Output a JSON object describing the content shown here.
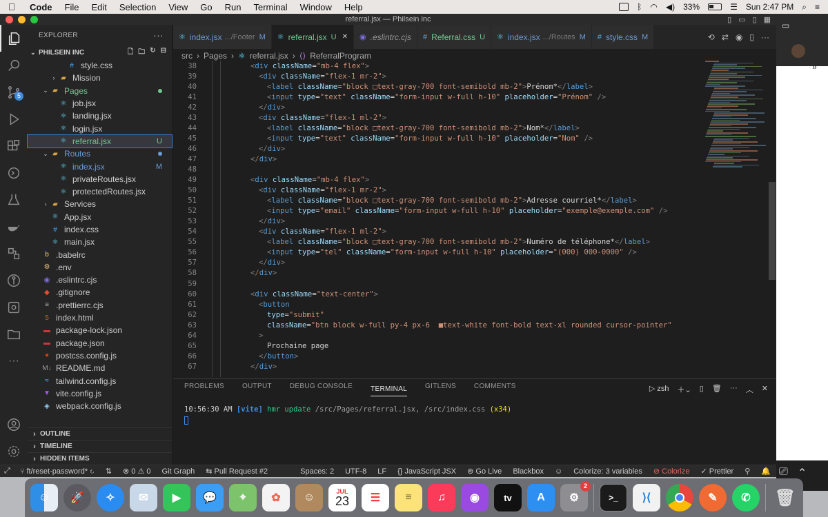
{
  "menubar": {
    "app": "Code",
    "items": [
      "File",
      "Edit",
      "Selection",
      "View",
      "Go",
      "Run",
      "Terminal",
      "Window",
      "Help"
    ],
    "battery": "33%",
    "clock": "Sun 2:47 PM"
  },
  "window": {
    "title": "referral.jsx — Philsein inc"
  },
  "sidebar": {
    "header": "EXPLORER",
    "workspace": "PHILSEIN INC",
    "tree": [
      {
        "name": "style.css",
        "indent": 3,
        "icon": "css",
        "chev": ""
      },
      {
        "name": "Mission",
        "indent": 2,
        "icon": "folder",
        "chev": "›"
      },
      {
        "name": "Pages",
        "indent": 1,
        "icon": "folder-open",
        "chev": "⌄",
        "status": "dot",
        "color": "green"
      },
      {
        "name": "job.jsx",
        "indent": 2,
        "icon": "react",
        "chev": ""
      },
      {
        "name": "landing.jsx",
        "indent": 2,
        "icon": "react",
        "chev": ""
      },
      {
        "name": "login.jsx",
        "indent": 2,
        "icon": "react",
        "chev": ""
      },
      {
        "name": "referral.jsx",
        "indent": 2,
        "icon": "react",
        "chev": "",
        "status": "U",
        "selected": true
      },
      {
        "name": "Routes",
        "indent": 1,
        "icon": "folder-open",
        "chev": "⌄",
        "status": "dot",
        "color": "blue"
      },
      {
        "name": "index.jsx",
        "indent": 2,
        "icon": "react",
        "chev": "",
        "status": "M",
        "color": "blue"
      },
      {
        "name": "privateRoutes.jsx",
        "indent": 2,
        "icon": "react",
        "chev": ""
      },
      {
        "name": "protectedRoutes.jsx",
        "indent": 2,
        "icon": "react",
        "chev": ""
      },
      {
        "name": "Services",
        "indent": 1,
        "icon": "folder",
        "chev": "›"
      },
      {
        "name": "App.jsx",
        "indent": 1,
        "icon": "react",
        "chev": ""
      },
      {
        "name": "index.css",
        "indent": 1,
        "icon": "css",
        "chev": ""
      },
      {
        "name": "main.jsx",
        "indent": 1,
        "icon": "react",
        "chev": ""
      },
      {
        "name": ".babelrc",
        "indent": 0,
        "icon": "babel",
        "chev": ""
      },
      {
        "name": ".env",
        "indent": 0,
        "icon": "env",
        "chev": ""
      },
      {
        "name": ".eslintrc.cjs",
        "indent": 0,
        "icon": "eslint",
        "chev": ""
      },
      {
        "name": ".gitignore",
        "indent": 0,
        "icon": "git",
        "chev": ""
      },
      {
        "name": ".prettierrc.cjs",
        "indent": 0,
        "icon": "prettier",
        "chev": ""
      },
      {
        "name": "index.html",
        "indent": 0,
        "icon": "html",
        "chev": ""
      },
      {
        "name": "package-lock.json",
        "indent": 0,
        "icon": "npm",
        "chev": ""
      },
      {
        "name": "package.json",
        "indent": 0,
        "icon": "npm",
        "chev": ""
      },
      {
        "name": "postcss.config.js",
        "indent": 0,
        "icon": "postcss",
        "chev": ""
      },
      {
        "name": "README.md",
        "indent": 0,
        "icon": "md",
        "chev": ""
      },
      {
        "name": "tailwind.config.js",
        "indent": 0,
        "icon": "tailwind",
        "chev": ""
      },
      {
        "name": "vite.config.js",
        "indent": 0,
        "icon": "vite",
        "chev": ""
      },
      {
        "name": "webpack.config.js",
        "indent": 0,
        "icon": "webpack",
        "chev": ""
      }
    ],
    "sections": [
      "OUTLINE",
      "TIMELINE",
      "HIDDEN ITEMS"
    ]
  },
  "tabs": [
    {
      "label": "index.jsx",
      "sub": ".../Footer",
      "mark": "M",
      "icon": "react",
      "markColor": "#6c9bd6"
    },
    {
      "label": "referral.jsx",
      "sub": "",
      "mark": "U",
      "icon": "react",
      "active": true,
      "markColor": "#73c991"
    },
    {
      "label": ".eslintrc.cjs",
      "sub": "",
      "mark": "",
      "icon": "eslint",
      "italic": true
    },
    {
      "label": "Referral.css",
      "sub": "",
      "mark": "U",
      "icon": "css",
      "markColor": "#73c991"
    },
    {
      "label": "index.jsx",
      "sub": ".../Routes",
      "mark": "M",
      "icon": "react",
      "markColor": "#6c9bd6"
    },
    {
      "label": "style.css",
      "sub": "",
      "mark": "M",
      "icon": "css",
      "markColor": "#6c9bd6"
    }
  ],
  "breadcrumb": [
    "src",
    "Pages",
    "referral.jsx",
    "ReferralProgram"
  ],
  "code": [
    {
      "n": "38",
      "i": 0,
      "h": [
        [
          "p",
          "<"
        ],
        [
          "t",
          "div "
        ],
        [
          "a",
          "className"
        ],
        [
          "x",
          "="
        ],
        [
          "s",
          "\"mb-4 flex\""
        ],
        [
          "p",
          ">"
        ]
      ]
    },
    {
      "n": "39",
      "i": 1,
      "h": [
        [
          "p",
          "<"
        ],
        [
          "t",
          "div "
        ],
        [
          "a",
          "className"
        ],
        [
          "x",
          "="
        ],
        [
          "s",
          "\"flex-1 mr-2\""
        ],
        [
          "p",
          ">"
        ]
      ]
    },
    {
      "n": "40",
      "i": 2,
      "h": [
        [
          "p",
          "<"
        ],
        [
          "t",
          "label "
        ],
        [
          "a",
          "className"
        ],
        [
          "x",
          "="
        ],
        [
          "s",
          "\"block □text-gray-700 font-semibold mb-2\""
        ],
        [
          "p",
          ">"
        ],
        [
          "x",
          "Prénom*"
        ],
        [
          "p",
          "</"
        ],
        [
          "t",
          "label"
        ],
        [
          "p",
          ">"
        ]
      ]
    },
    {
      "n": "41",
      "i": 2,
      "h": [
        [
          "p",
          "<"
        ],
        [
          "t",
          "input "
        ],
        [
          "a",
          "type"
        ],
        [
          "x",
          "="
        ],
        [
          "s",
          "\"text\" "
        ],
        [
          "a",
          "className"
        ],
        [
          "x",
          "="
        ],
        [
          "s",
          "\"form-input w-full h-10\" "
        ],
        [
          "a",
          "placeholder"
        ],
        [
          "x",
          "="
        ],
        [
          "s",
          "\"Prénom\" "
        ],
        [
          "p",
          "/>"
        ]
      ]
    },
    {
      "n": "42",
      "i": 1,
      "h": [
        [
          "p",
          "</"
        ],
        [
          "t",
          "div"
        ],
        [
          "p",
          ">"
        ]
      ]
    },
    {
      "n": "43",
      "i": 1,
      "h": [
        [
          "p",
          "<"
        ],
        [
          "t",
          "div "
        ],
        [
          "a",
          "className"
        ],
        [
          "x",
          "="
        ],
        [
          "s",
          "\"flex-1 ml-2\""
        ],
        [
          "p",
          ">"
        ]
      ]
    },
    {
      "n": "44",
      "i": 2,
      "h": [
        [
          "p",
          "<"
        ],
        [
          "t",
          "label "
        ],
        [
          "a",
          "className"
        ],
        [
          "x",
          "="
        ],
        [
          "s",
          "\"block □text-gray-700 font-semibold mb-2\""
        ],
        [
          "p",
          ">"
        ],
        [
          "x",
          "Nom*"
        ],
        [
          "p",
          "</"
        ],
        [
          "t",
          "label"
        ],
        [
          "p",
          ">"
        ]
      ]
    },
    {
      "n": "45",
      "i": 2,
      "h": [
        [
          "p",
          "<"
        ],
        [
          "t",
          "input "
        ],
        [
          "a",
          "type"
        ],
        [
          "x",
          "="
        ],
        [
          "s",
          "\"text\" "
        ],
        [
          "a",
          "className"
        ],
        [
          "x",
          "="
        ],
        [
          "s",
          "\"form-input w-full h-10\" "
        ],
        [
          "a",
          "placeholder"
        ],
        [
          "x",
          "="
        ],
        [
          "s",
          "\"Nom\" "
        ],
        [
          "p",
          "/>"
        ]
      ]
    },
    {
      "n": "46",
      "i": 1,
      "h": [
        [
          "p",
          "</"
        ],
        [
          "t",
          "div"
        ],
        [
          "p",
          ">"
        ]
      ]
    },
    {
      "n": "47",
      "i": 0,
      "h": [
        [
          "p",
          "</"
        ],
        [
          "t",
          "div"
        ],
        [
          "p",
          ">"
        ]
      ]
    },
    {
      "n": "48",
      "i": 0,
      "h": []
    },
    {
      "n": "49",
      "i": 0,
      "h": [
        [
          "p",
          "<"
        ],
        [
          "t",
          "div "
        ],
        [
          "a",
          "className"
        ],
        [
          "x",
          "="
        ],
        [
          "s",
          "\"mb-4 flex\""
        ],
        [
          "p",
          ">"
        ]
      ]
    },
    {
      "n": "50",
      "i": 1,
      "h": [
        [
          "p",
          "<"
        ],
        [
          "t",
          "div "
        ],
        [
          "a",
          "className"
        ],
        [
          "x",
          "="
        ],
        [
          "s",
          "\"flex-1 mr-2\""
        ],
        [
          "p",
          ">"
        ]
      ]
    },
    {
      "n": "51",
      "i": 2,
      "h": [
        [
          "p",
          "<"
        ],
        [
          "t",
          "label "
        ],
        [
          "a",
          "className"
        ],
        [
          "x",
          "="
        ],
        [
          "s",
          "\"block □text-gray-700 font-semibold mb-2\""
        ],
        [
          "p",
          ">"
        ],
        [
          "x",
          "Adresse courriel*"
        ],
        [
          "p",
          "</"
        ],
        [
          "t",
          "label"
        ],
        [
          "p",
          ">"
        ]
      ]
    },
    {
      "n": "52",
      "i": 2,
      "h": [
        [
          "p",
          "<"
        ],
        [
          "t",
          "input "
        ],
        [
          "a",
          "type"
        ],
        [
          "x",
          "="
        ],
        [
          "s",
          "\"email\" "
        ],
        [
          "a",
          "className"
        ],
        [
          "x",
          "="
        ],
        [
          "s",
          "\"form-input w-full h-10\" "
        ],
        [
          "a",
          "placeholder"
        ],
        [
          "x",
          "="
        ],
        [
          "s",
          "\"exemple@exemple.com\" "
        ],
        [
          "p",
          "/>"
        ]
      ]
    },
    {
      "n": "53",
      "i": 1,
      "h": [
        [
          "p",
          "</"
        ],
        [
          "t",
          "div"
        ],
        [
          "p",
          ">"
        ]
      ]
    },
    {
      "n": "54",
      "i": 1,
      "h": [
        [
          "p",
          "<"
        ],
        [
          "t",
          "div "
        ],
        [
          "a",
          "className"
        ],
        [
          "x",
          "="
        ],
        [
          "s",
          "\"flex-1 ml-2\""
        ],
        [
          "p",
          ">"
        ]
      ]
    },
    {
      "n": "55",
      "i": 2,
      "h": [
        [
          "p",
          "<"
        ],
        [
          "t",
          "label "
        ],
        [
          "a",
          "className"
        ],
        [
          "x",
          "="
        ],
        [
          "s",
          "\"block □text-gray-700 font-semibold mb-2\""
        ],
        [
          "p",
          ">"
        ],
        [
          "x",
          "Numéro de téléphone*"
        ],
        [
          "p",
          "</"
        ],
        [
          "t",
          "label"
        ],
        [
          "p",
          ">"
        ]
      ]
    },
    {
      "n": "56",
      "i": 2,
      "h": [
        [
          "p",
          "<"
        ],
        [
          "t",
          "input "
        ],
        [
          "a",
          "type"
        ],
        [
          "x",
          "="
        ],
        [
          "s",
          "\"tel\" "
        ],
        [
          "a",
          "className"
        ],
        [
          "x",
          "="
        ],
        [
          "s",
          "\"form-input w-full h-10\" "
        ],
        [
          "a",
          "placeholder"
        ],
        [
          "x",
          "="
        ],
        [
          "s",
          "\"(000) 000-0000\" "
        ],
        [
          "p",
          "/>"
        ]
      ]
    },
    {
      "n": "57",
      "i": 1,
      "h": [
        [
          "p",
          "</"
        ],
        [
          "t",
          "div"
        ],
        [
          "p",
          ">"
        ]
      ]
    },
    {
      "n": "58",
      "i": 0,
      "h": [
        [
          "p",
          "</"
        ],
        [
          "t",
          "div"
        ],
        [
          "p",
          ">"
        ]
      ]
    },
    {
      "n": "59",
      "i": 0,
      "h": []
    },
    {
      "n": "60",
      "i": 0,
      "h": [
        [
          "p",
          "<"
        ],
        [
          "t",
          "div "
        ],
        [
          "a",
          "className"
        ],
        [
          "x",
          "="
        ],
        [
          "s",
          "\"text-center\""
        ],
        [
          "p",
          ">"
        ]
      ]
    },
    {
      "n": "61",
      "i": 1,
      "h": [
        [
          "p",
          "<"
        ],
        [
          "t",
          "button"
        ]
      ]
    },
    {
      "n": "62",
      "i": 2,
      "h": [
        [
          "a",
          "type"
        ],
        [
          "x",
          "="
        ],
        [
          "s",
          "\"submit\""
        ]
      ]
    },
    {
      "n": "63",
      "i": 2,
      "h": [
        [
          "a",
          "className"
        ],
        [
          "x",
          "="
        ],
        [
          "s",
          "\"btn block w-full py-4 px-6  ■text-white font-bold text-xl rounded cursor-pointer\""
        ]
      ]
    },
    {
      "n": "64",
      "i": 1,
      "h": [
        [
          "p",
          ">"
        ]
      ]
    },
    {
      "n": "65",
      "i": 2,
      "h": [
        [
          "x",
          "Prochaine page"
        ]
      ]
    },
    {
      "n": "66",
      "i": 1,
      "h": [
        [
          "p",
          "</"
        ],
        [
          "t",
          "button"
        ],
        [
          "p",
          ">"
        ]
      ]
    },
    {
      "n": "67",
      "i": 0,
      "h": [
        [
          "p",
          "</"
        ],
        [
          "t",
          "div"
        ],
        [
          "p",
          ">"
        ]
      ]
    }
  ],
  "panel": {
    "tabs": [
      "PROBLEMS",
      "OUTPUT",
      "DEBUG CONSOLE",
      "TERMINAL",
      "GITLENS",
      "COMMENTS"
    ],
    "active_tab": "TERMINAL",
    "shell": "zsh",
    "terminal_time": "10:56:30 AM",
    "terminal_tag": "[vite]",
    "terminal_msg": "hmr update",
    "terminal_paths": "/src/Pages/referral.jsx, /src/index.css",
    "terminal_count": "(x34)"
  },
  "status": {
    "branch": "ft/reset-password*",
    "problems": "0",
    "warnings": "0",
    "git_graph": "Git Graph",
    "pull_request": "Pull Request #2",
    "spaces": "Spaces: 2",
    "encoding": "UTF-8",
    "eol": "LF",
    "language": "JavaScript JSX",
    "golive": "Go Live",
    "blackbox": "Blackbox",
    "colorize_vars": "Colorize: 3 variables",
    "colorize": "Colorize",
    "prettier": "Prettier"
  },
  "dock": {
    "calendar_month": "JUL",
    "calendar_day": "23",
    "settings_badge": "2",
    "appletv_label": "tv"
  }
}
